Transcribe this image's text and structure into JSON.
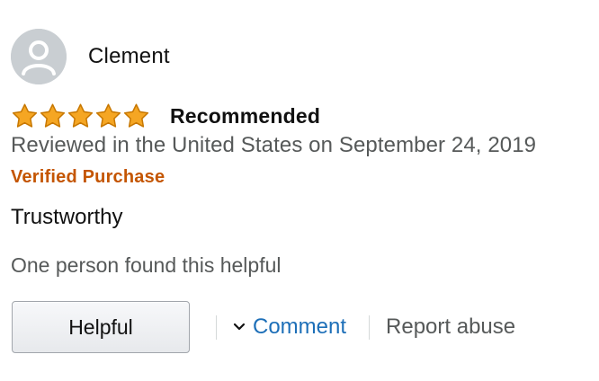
{
  "reviewer": {
    "name": "Clement",
    "avatar_icon": "default-user-avatar"
  },
  "rating": {
    "stars": 5,
    "max_stars": 5,
    "star_color": "#f5a623",
    "title": "Recommended"
  },
  "meta": {
    "reviewed_text": "Reviewed in the United States on September 24, 2019",
    "verified_label": "Verified Purchase",
    "verified_color": "#c45500"
  },
  "body": {
    "text": "Trustworthy"
  },
  "helpful": {
    "count_text": "One person found this helpful",
    "button_label": "Helpful"
  },
  "links": {
    "comment_label": "Comment",
    "comment_icon": "chevron-down-icon",
    "report_label": "Report abuse",
    "link_color": "#1d6fb8"
  }
}
